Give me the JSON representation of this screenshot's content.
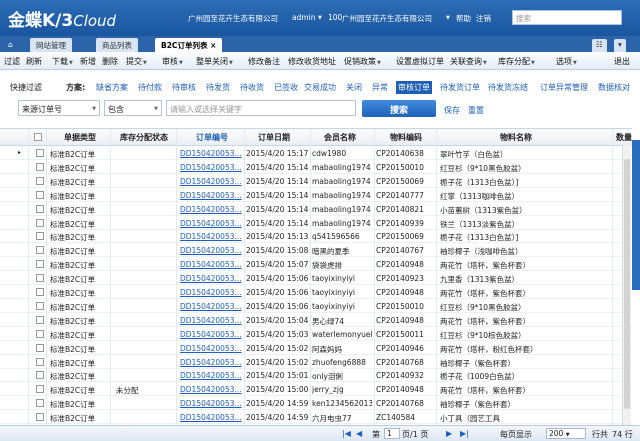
{
  "app": {
    "logo_main": "金蝶",
    "logo_sub": "K/3",
    "logo_cloud": "Cloud",
    "company": "广州园至花卉生态有限公司",
    "user": "admin",
    "org_code": "100",
    "org_name": "广州园至花卉生态有限公司",
    "help": "帮助",
    "logout": "注销",
    "search_placeholder": "搜索"
  },
  "tabs": [
    {
      "label": "网站管理"
    },
    {
      "label": "商品列表"
    },
    {
      "label": "B2C订单列表"
    }
  ],
  "toolbar": [
    {
      "label": "过滤"
    },
    {
      "label": "刷新"
    },
    {
      "label": "下载"
    },
    {
      "label": "新增"
    },
    {
      "label": "删除"
    },
    {
      "label": "提交"
    },
    {
      "label": "审核"
    },
    {
      "label": "整单关闭"
    },
    {
      "label": "修改备注"
    },
    {
      "label": "修改收货地址"
    },
    {
      "label": "促销政策"
    },
    {
      "label": "设置虚拟订单"
    },
    {
      "label": "关联查询"
    },
    {
      "label": "库存分配"
    },
    {
      "label": "选项"
    },
    {
      "label": "退出"
    }
  ],
  "filters": {
    "quick_label": "快捷过滤",
    "scheme_label": "方案:",
    "items": [
      "缺省方案",
      "待付款",
      "待审核",
      "待发货",
      "待收货",
      "已签收",
      "交易成功",
      "关闭",
      "异常",
      "审核订单",
      "待发货订单",
      "待发货冻结",
      "订单异常管理",
      "数据核对"
    ],
    "active": "审核订单"
  },
  "search": {
    "field_value": "来源订单号",
    "op_value": "包含",
    "keyword_placeholder": "请输入或选择关键字",
    "button": "搜索",
    "save": "保存",
    "reset": "重置"
  },
  "grid": {
    "headers": [
      "单据类型",
      "库存分配状态",
      "订单编号",
      "订单日期",
      "会员名称",
      "物料编码",
      "物料名称",
      "数量"
    ],
    "rows": [
      {
        "type": "标准B2C订单",
        "alloc": "",
        "no": "DD150420053...",
        "date": "2015/4/20 15:17:2",
        "member": "cdw1980",
        "code": "CP20140638",
        "name": "翠叶竹芋（白色盆）"
      },
      {
        "type": "标准B2C订单",
        "alloc": "",
        "no": "DD150420053...",
        "date": "2015/4/20 15:14:3",
        "member": "mabaoling1974",
        "code": "CP20150010",
        "name": "红豆杉（9*10黑色胶盆）"
      },
      {
        "type": "标准B2C订单",
        "alloc": "",
        "no": "DD150420053...",
        "date": "2015/4/20 15:14:3",
        "member": "mabaoling1974",
        "code": "CP20150069",
        "name": "栀子花（1313白色盆）]"
      },
      {
        "type": "标准B2C订单",
        "alloc": "",
        "no": "DD150420053...",
        "date": "2015/4/20 15:14:3",
        "member": "mabaoling1974",
        "code": "CP20140777",
        "name": "红掌（1313咖啡色盆）"
      },
      {
        "type": "标准B2C订单",
        "alloc": "",
        "no": "DD150420053...",
        "date": "2015/4/20 15:14:3",
        "member": "mabaoling1974",
        "code": "CP20140821",
        "name": "小苗蕙树（1313紫色盆）"
      },
      {
        "type": "标准B2C订单",
        "alloc": "",
        "no": "DD150420053...",
        "date": "2015/4/20 15:14:3",
        "member": "mabaoling1974",
        "code": "CP20140939",
        "name": "铁兰（1313淡紫色盆）"
      },
      {
        "type": "标准B2C订单",
        "alloc": "",
        "no": "DD150420053...",
        "date": "2015/4/20 15:13:2",
        "member": "q541596566",
        "code": "CP20150069",
        "name": "栀子花（1313白色盆）]"
      },
      {
        "type": "标准B2C订单",
        "alloc": "",
        "no": "DD150420053...",
        "date": "2015/4/20 15:08:1",
        "member": "暗黑的夏季",
        "code": "CP20140767",
        "name": "袖珍椰子（浅咖啡色盆）"
      },
      {
        "type": "标准B2C订单",
        "alloc": "",
        "no": "DD150420053...",
        "date": "2015/4/20 15:07:2",
        "member": "袋袋虎排",
        "code": "CP20140948",
        "name": "两花竹（塔杯，紫色杯套）"
      },
      {
        "type": "标准B2C订单",
        "alloc": "",
        "no": "DD150420053...",
        "date": "2015/4/20 15:06:1",
        "member": "taoyixinyiyi",
        "code": "CP20140923",
        "name": "九里香（1313紫色盆）"
      },
      {
        "type": "标准B2C订单",
        "alloc": "",
        "no": "DD150420053...",
        "date": "2015/4/20 15:06:1",
        "member": "taoyixinyiyi",
        "code": "CP20140948",
        "name": "两花竹（塔杯，紫色杯套）"
      },
      {
        "type": "标准B2C订单",
        "alloc": "",
        "no": "DD150420053...",
        "date": "2015/4/20 15:06:1",
        "member": "taoyixinyiyi",
        "code": "CP20150010",
        "name": "红豆杉（9*10黑色胶盆）"
      },
      {
        "type": "标准B2C订单",
        "alloc": "",
        "no": "DD150420053...",
        "date": "2015/4/20 15:04:4",
        "member": "男心绿74",
        "code": "CP20140948",
        "name": "两花竹（塔杯，紫色杯套）"
      },
      {
        "type": "标准B2C订单",
        "alloc": "",
        "no": "DD150420053...",
        "date": "2015/4/20 15:03:3",
        "member": "waterlemonyuelai",
        "code": "CP20150011",
        "name": "红豆杉（9*10棕色胶盆）"
      },
      {
        "type": "标准B2C订单",
        "alloc": "",
        "no": "DD150420053...",
        "date": "2015/4/20 15:02:5",
        "member": "阿森妈妈",
        "code": "CP20140946",
        "name": "两花竹（塔杯，粉红色杯套）"
      },
      {
        "type": "标准B2C订单",
        "alloc": "",
        "no": "DD150420053...",
        "date": "2015/4/20 15:02:3",
        "member": "zhuofeng6888",
        "code": "CP20140768",
        "name": "袖珍椰子（紫色杯套）"
      },
      {
        "type": "标准B2C订单",
        "alloc": "",
        "no": "DD150420053...",
        "date": "2015/4/20 15:01:3",
        "member": "only泪俐",
        "code": "CP20140932",
        "name": "栀子花（1009白色盆）"
      },
      {
        "type": "标准B2C订单",
        "alloc": "未分配",
        "no": "DD150420053...",
        "date": "2015/4/20 15:00:5",
        "member": "jerry_zjg",
        "code": "CP20140948",
        "name": "两花竹（塔杯，紫色杯套）"
      },
      {
        "type": "标准B2C订单",
        "alloc": "",
        "no": "DD150420053...",
        "date": "2015/4/20 14:59:4",
        "member": "ken1234562013",
        "code": "CP20140768",
        "name": "袖珍椰子（紫色杯套）"
      },
      {
        "type": "标准B2C订单",
        "alloc": "",
        "no": "DD150420053...",
        "date": "2015/4/20 14:59:4",
        "member": "六月电虫77",
        "code": "ZC140584",
        "name": "小丁具（园艺工具"
      }
    ]
  },
  "footer": {
    "page_prefix": "第",
    "page_value": "1",
    "page_suffix": "页/1 页",
    "per_page_label": "每页显示",
    "per_page_value": "200",
    "rows_label": "行共",
    "rows_count": "74 行"
  }
}
